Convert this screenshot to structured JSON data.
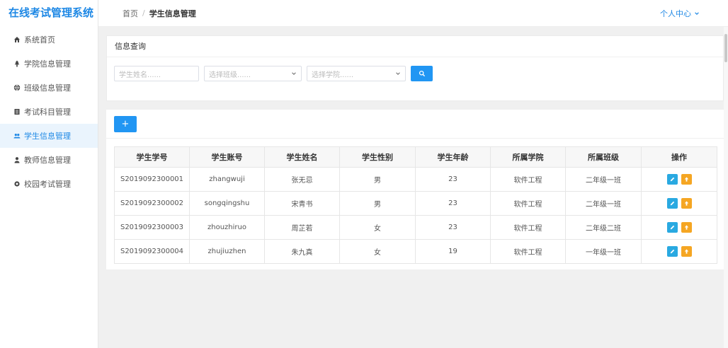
{
  "app": {
    "title": "在线考试管理系统"
  },
  "sidebar": {
    "items": [
      {
        "label": "系统首页",
        "icon": "home-icon"
      },
      {
        "label": "学院信息管理",
        "icon": "tree-icon"
      },
      {
        "label": "班级信息管理",
        "icon": "globe-icon"
      },
      {
        "label": "考试科目管理",
        "icon": "book-icon"
      },
      {
        "label": "学生信息管理",
        "icon": "users-icon",
        "active": true
      },
      {
        "label": "教师信息管理",
        "icon": "user-icon"
      },
      {
        "label": "校园考试管理",
        "icon": "gear-icon"
      }
    ]
  },
  "header": {
    "breadcrumb_home": "首页",
    "breadcrumb_sep": "/",
    "breadcrumb_current": "学生信息管理",
    "user_center": "个人中心"
  },
  "query": {
    "title": "信息查询",
    "name_placeholder": "学生姓名......",
    "class_placeholder": "选择班级......",
    "college_placeholder": "选择学院......"
  },
  "list": {
    "add_label": "+",
    "columns": [
      "学生学号",
      "学生账号",
      "学生姓名",
      "学生性别",
      "学生年龄",
      "所属学院",
      "所属班级",
      "操作"
    ],
    "rows": [
      [
        "S2019092300001",
        "zhangwuji",
        "张无忌",
        "男",
        "23",
        "软件工程",
        "二年级一班"
      ],
      [
        "S2019092300002",
        "songqingshu",
        "宋青书",
        "男",
        "23",
        "软件工程",
        "二年级一班"
      ],
      [
        "S2019092300003",
        "zhouzhiruo",
        "周芷若",
        "女",
        "23",
        "软件工程",
        "二年级二班"
      ],
      [
        "S2019092300004",
        "zhujiuzhen",
        "朱九真",
        "女",
        "19",
        "软件工程",
        "一年级一班"
      ]
    ]
  },
  "colors": {
    "accent": "#1e88e5",
    "primary_button": "#2196f3",
    "edit_button": "#29a9e1",
    "delete_button": "#f5a623"
  }
}
